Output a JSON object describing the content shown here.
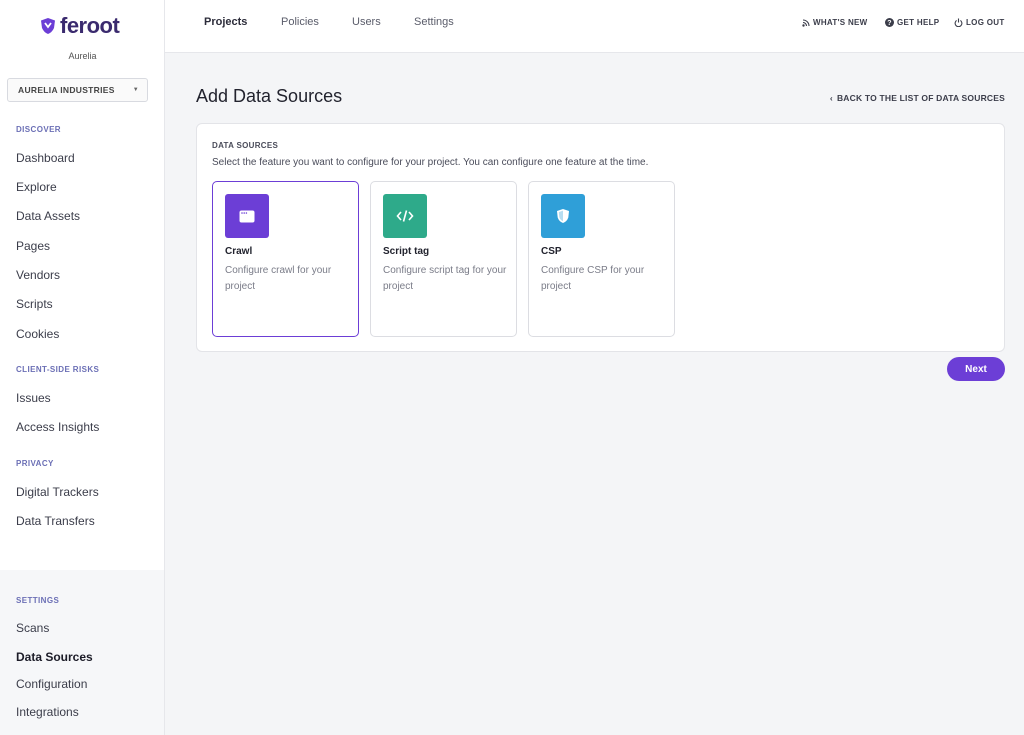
{
  "app": {
    "brand": "feroot",
    "org_name": "Aurelia",
    "org_select": "AURELIA INDUSTRIES"
  },
  "sidebar": {
    "sections": [
      {
        "label": "DISCOVER",
        "items": [
          "Dashboard",
          "Explore",
          "Data Assets",
          "Pages",
          "Vendors",
          "Scripts",
          "Cookies"
        ]
      },
      {
        "label": "CLIENT-SIDE RISKS",
        "items": [
          "Issues",
          "Access Insights"
        ]
      },
      {
        "label": "PRIVACY",
        "items": [
          "Digital Trackers",
          "Data Transfers"
        ]
      },
      {
        "label": "SETTINGS",
        "items": [
          "Scans",
          "Data Sources",
          "Configuration",
          "Integrations"
        ]
      }
    ],
    "active_item": "Data Sources"
  },
  "topbar": {
    "tabs": [
      "Projects",
      "Policies",
      "Users",
      "Settings"
    ],
    "active_tab": "Projects",
    "links": [
      "WHAT'S NEW",
      "GET HELP",
      "LOG OUT"
    ]
  },
  "main": {
    "title": "Add Data Sources",
    "back_link": "BACK TO THE LIST OF DATA SOURCES",
    "panel": {
      "heading": "DATA SOURCES",
      "description": "Select the feature you want to configure for your project. You can configure one feature at the time.",
      "cards": [
        {
          "title": "Crawl",
          "description": "Configure crawl for your project",
          "icon": "browser-window-icon",
          "color": "#6c3ed6",
          "selected": true
        },
        {
          "title": "Script tag",
          "description": "Configure script tag for your project",
          "icon": "code-icon",
          "color": "#2eaa8a",
          "selected": false
        },
        {
          "title": "CSP",
          "description": "Configure CSP for your project",
          "icon": "shield-icon",
          "color": "#2f9fd8",
          "selected": false
        }
      ]
    },
    "next_label": "Next"
  },
  "colors": {
    "accent": "#6c3ed6",
    "nav_section": "#6b6fb5"
  }
}
